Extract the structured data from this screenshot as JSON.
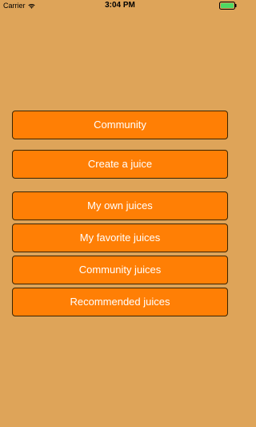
{
  "status_bar": {
    "carrier": "Carrier",
    "time": "3:04 PM",
    "wifi_icon": "wifi-icon",
    "battery_icon": "battery-icon",
    "battery_color": "#4cd964"
  },
  "menu": {
    "button_color": "#ff7f05",
    "background_color": "#dea459",
    "items": [
      {
        "label": "Community"
      },
      {
        "label": "Create a juice"
      },
      {
        "label": "My own juices"
      },
      {
        "label": "My favorite juices"
      },
      {
        "label": "Community juices"
      },
      {
        "label": "Recommended juices"
      }
    ]
  }
}
